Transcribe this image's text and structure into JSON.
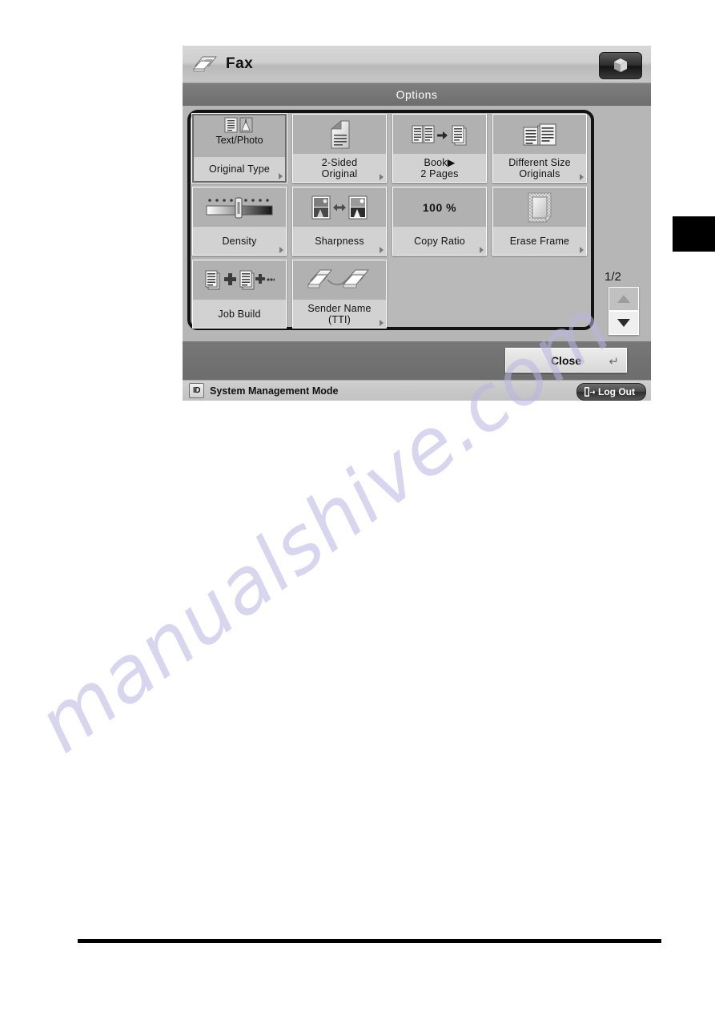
{
  "header": {
    "title": "Fax",
    "fax_icon": "fax-machine-icon",
    "cube_button_icon": "cube-icon"
  },
  "options_band": {
    "title": "Options"
  },
  "grid": {
    "buttons": [
      {
        "name": "original-type",
        "label": "Original Type",
        "value": "Text/Photo",
        "icon": "text-photo-icon",
        "selected": true,
        "has_arrow": true
      },
      {
        "name": "two-sided-original",
        "label": "2-Sided\nOriginal",
        "label_line1": "2-Sided",
        "label_line2": "Original",
        "icon": "folded-page-icon",
        "selected": false,
        "has_arrow": true
      },
      {
        "name": "book-to-2-pages",
        "label": "Book▶\n2 Pages",
        "label_line1": "Book▶",
        "label_line2": "2 Pages",
        "icon": "book-to-pages-icon",
        "selected": false,
        "has_arrow": false
      },
      {
        "name": "different-size-originals",
        "label": "Different Size\nOriginals",
        "label_line1": "Different Size",
        "label_line2": "Originals",
        "icon": "open-book-icon",
        "selected": false,
        "has_arrow": true
      },
      {
        "name": "density",
        "label": "Density",
        "icon": "density-slider-icon",
        "selected": false,
        "has_arrow": true
      },
      {
        "name": "sharpness",
        "label": "Sharpness",
        "icon": "sharpness-compare-icon",
        "selected": false,
        "has_arrow": true
      },
      {
        "name": "copy-ratio",
        "label": "Copy Ratio",
        "value": "100 %",
        "icon": "ratio-value-icon",
        "selected": false,
        "has_arrow": true
      },
      {
        "name": "erase-frame",
        "label": "Erase Frame",
        "icon": "erase-frame-page-icon",
        "selected": false,
        "has_arrow": true
      },
      {
        "name": "job-build",
        "label": "Job Build",
        "icon": "job-build-stack-icon",
        "selected": false,
        "has_arrow": false
      },
      {
        "name": "sender-name-tti",
        "label": "Sender Name\n(TTI)",
        "label_line1": "Sender Name",
        "label_line2": "(TTI)",
        "icon": "two-fax-machines-icon",
        "selected": false,
        "has_arrow": true
      }
    ]
  },
  "right_rail": {
    "page_indicator": "1/2",
    "scroll_up_icon": "triangle-up-icon",
    "scroll_down_icon": "triangle-down-icon"
  },
  "footer": {
    "close_label": "Close",
    "enter_glyph": "↵"
  },
  "status_bar": {
    "id_badge": "ID",
    "mode_text": "System Management Mode",
    "logout_label": "Log Out",
    "logout_icon": "logout-arrow-icon"
  },
  "watermark": {
    "text": "manualshive.com"
  },
  "colors": {
    "screen_bg": "#b6b6b6",
    "header_bg": "#cfcfcf",
    "band_bg": "#6e6e6e",
    "button_face": "#d2d2d2",
    "icon_area": "#b1b1b1",
    "footer_bg": "#6d6d6d",
    "status_bg": "#c6c6c6",
    "watermark": "#b9b6e2",
    "accent_black": "#000000"
  }
}
